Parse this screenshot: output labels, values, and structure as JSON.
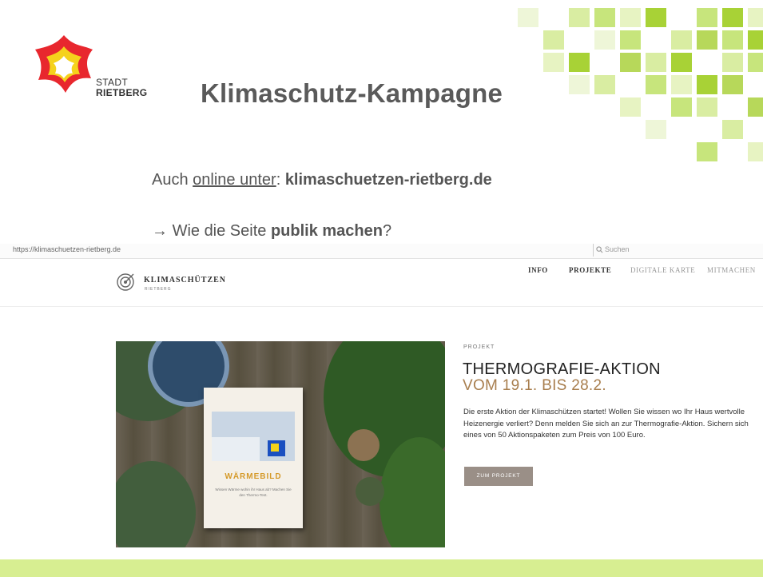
{
  "slide": {
    "org_line1": "STADT",
    "org_line2": "RIETBERG",
    "title": "Klimaschutz-Kampagne",
    "online_prefix": "Auch ",
    "online_link": "online unter",
    "online_colon": ": ",
    "online_domain": "klimaschuetzen-rietberg.de",
    "publik_arrow": "→ ",
    "publik_prefix": "Wie die Seite ",
    "publik_bold": "publik machen",
    "publik_suffix": "?"
  },
  "browser": {
    "url": "https://klimaschuetzen-rietberg.de",
    "search_placeholder": "Suchen"
  },
  "site": {
    "brand": "KLIMASCHÜTZEN",
    "brand_sub": "RIETBERG",
    "nav": [
      {
        "label": "INFO"
      },
      {
        "label": "PROJEKTE"
      },
      {
        "label": "DIGITALE KARTE"
      },
      {
        "label": "MITMACHEN"
      }
    ],
    "kicker": "PROJEKT",
    "headline": "THERMOGRAFIE-AKTION",
    "dateline": "VOM 19.1. BIS 28.2.",
    "description": "Die erste Aktion der Klimaschützen startet! Wollen Sie wissen wo Ihr Haus wertvolle Heizenergie verliert? Denn melden Sie sich an zur Thermografie-Aktion. Sichern sich eines von 50 Aktionspaketen zum Preis von 100 Euro.",
    "cta": "ZUM PROJEKT",
    "flyer_title": "WÄRMEBILD",
    "flyer_text": "Wissen Wärme wohin ihr Haus ab? Machen Sie den Thermo-Test."
  },
  "colors": {
    "accent_green": "#b7d85a",
    "title_gray": "#5a5a5a",
    "date_brown": "#a87e4e",
    "button_gray": "#9a8f87",
    "bottom_strip": "#d7ee91"
  },
  "icons": {
    "logo": "stadt-rietberg-star-logo",
    "site_logo": "klimaschuetzen-target-logo",
    "search": "search-icon"
  }
}
